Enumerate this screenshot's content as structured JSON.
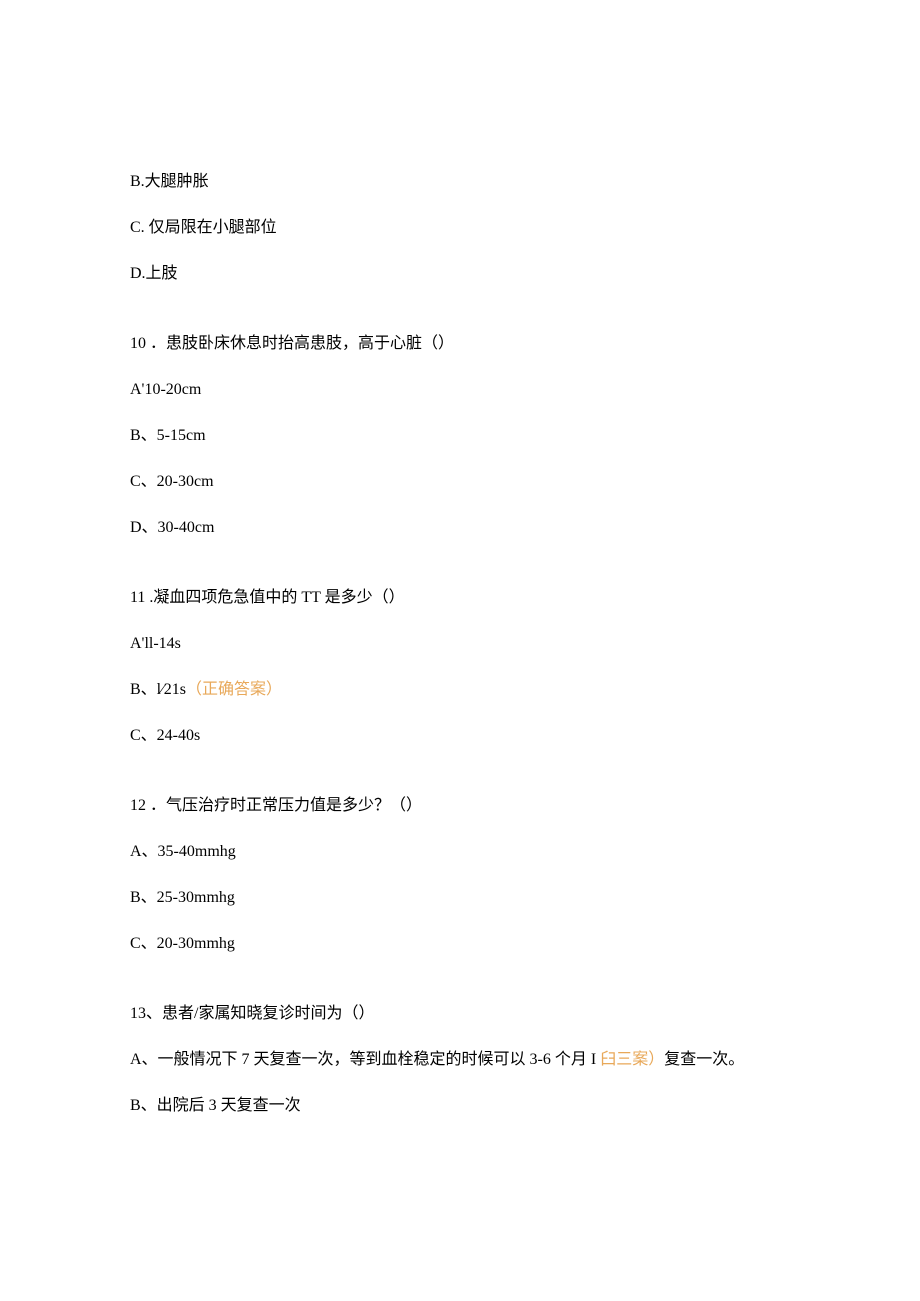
{
  "q9_options": {
    "b": "B.大腿肿胀",
    "c": "C. 仅局限在小腿部位",
    "d": "D.上肢"
  },
  "q10": {
    "stem": "10 ．患肢卧床休息时抬高患肢，高于心脏（）",
    "a": "A'10-20cm",
    "b": "B、5-15cm",
    "c": "C、20-30cm",
    "d": "D、30-40cm"
  },
  "q11": {
    "stem": "11 .凝血四项危急值中的 TT 是多少（）",
    "a": "A'll-14s",
    "b_prefix": "B、l∕21s",
    "b_correct": "（正确答案）",
    "c": "C、24-40s"
  },
  "q12": {
    "stem": "12 ．气压治疗时正常压力值是多少？（）",
    "a": "A、35-40mmhg",
    "b": "B、25-30mmhg",
    "c": "C、20-30mmhg"
  },
  "q13": {
    "stem": "13、患者/家属知晓复诊时间为（）",
    "a_prefix": "A、一般情况下 7 天复查一次，等到血栓稳定的时候可以 3-6 个月 I ",
    "a_highlight": "臼三案）",
    "a_suffix": "复查一次。",
    "b": "B、出院后 3 天复查一次"
  }
}
